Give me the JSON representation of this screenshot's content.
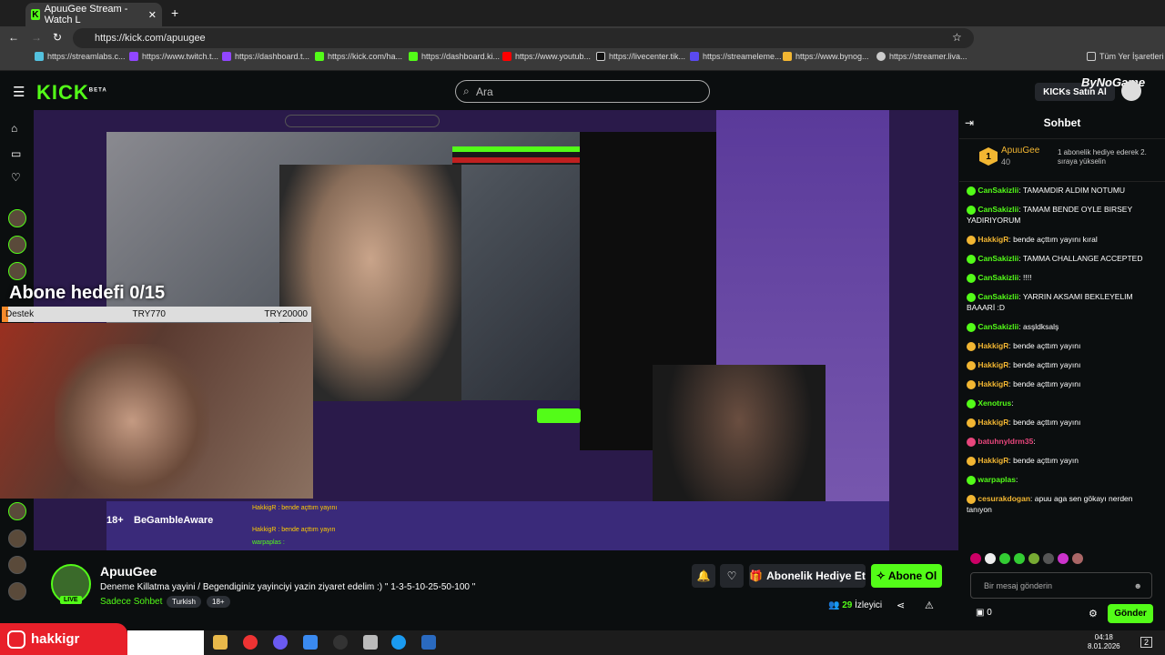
{
  "browser": {
    "tab_title": "ApuuGee Stream - Watch L",
    "url": "https://kick.com/apuugee",
    "bookmarks": [
      "https://streamlabs.c...",
      "https://www.twitch.t...",
      "https://dashboard.t...",
      "https://kick.com/ha...",
      "https://dashboard.ki...",
      "https://www.youtub...",
      "https://livecenter.tik...",
      "https://streameleme...",
      "https://www.bynog...",
      "https://streamer.liva..."
    ],
    "all_bookmarks": "Tüm Yer İşaretleri"
  },
  "header": {
    "logo": "KICK",
    "logo_sup": "BETA",
    "search_placeholder": "Ara",
    "kicks_button": "KICKs Satın Al",
    "overlay_logo": "ByNoGame"
  },
  "video": {
    "goal_title": "Abone hedefi 0/15",
    "goal_left": "Destek",
    "goal_mid": "TRY770",
    "goal_right": "TRY20000",
    "goal_progress": 0.0,
    "begamble": "BeGambleAware",
    "age": "18+",
    "overlay_lines": [
      "HakkigR : bende açttım yayını",
      "HakkigR : bende açttım yayın",
      "warpaplas :"
    ]
  },
  "stream": {
    "name": "ApuuGee",
    "title": "Deneme Killatma yayini / Begendiginiz yayinciyi yazin ziyaret edelim :) \" 1-3-5-10-25-50-100 \"",
    "category": "Sadece Sohbet",
    "tags": [
      "Turkish",
      "18+"
    ],
    "live": "LIVE",
    "viewers": "29",
    "viewers_label": "İzleyici",
    "gift_label": "Abonelik Hediye Et",
    "sub_label": "Abone Ol"
  },
  "chat": {
    "title": "Sohbet",
    "pinned": {
      "rank": "1",
      "name": "ApuuGee",
      "count": "40",
      "text": "1 abonelik hediye ederek 2. sıraya yükselin"
    },
    "messages": [
      {
        "user": "CanSakizlii",
        "color": "#53fc18",
        "text": "TAMAMDIR ALDIM NOTUMU"
      },
      {
        "user": "CanSakizlii",
        "color": "#53fc18",
        "text": "TAMAM BENDE OYLE BIRSEY YADIRIYORUM"
      },
      {
        "user": "HakkigR",
        "color": "#f2b632",
        "text": "bende açttım yayını kıral"
      },
      {
        "user": "CanSakizlii",
        "color": "#53fc18",
        "text": "TAMMA CHALLANGE ACCEPTED"
      },
      {
        "user": "CanSakizlii",
        "color": "#53fc18",
        "text": "!!!!"
      },
      {
        "user": "CanSakizlii",
        "color": "#53fc18",
        "text": "YARRIN AKSAMI BEKLEYELIM BAAARİ :D"
      },
      {
        "user": "CanSakizlii",
        "color": "#53fc18",
        "text": "asşldksalş"
      },
      {
        "user": "HakkigR",
        "color": "#f2b632",
        "text": "bende açttım yayını"
      },
      {
        "user": "HakkigR",
        "color": "#f2b632",
        "text": "bende açttım yayını"
      },
      {
        "user": "HakkigR",
        "color": "#f2b632",
        "text": "bende açttım yayını"
      },
      {
        "user": "Xenotrus",
        "color": "#53fc18",
        "text": ""
      },
      {
        "user": "HakkigR",
        "color": "#f2b632",
        "text": "bende açttım yayını"
      },
      {
        "user": "batuhnyldrm35",
        "color": "#e8467c",
        "text": ""
      },
      {
        "user": "HakkigR",
        "color": "#f2b632",
        "text": "bende açttım yayın"
      },
      {
        "user": "warpaplas",
        "color": "#53fc18",
        "text": ""
      },
      {
        "user": "cesurakdogan",
        "color": "#f2b632",
        "text": "apuu aga sen gökayı nerden tanıyon"
      }
    ],
    "input_placeholder": "Bir mesaj gönderin",
    "points": "0",
    "send_label": "Gönder"
  },
  "taskbar": {
    "instagram": "hakkigr",
    "time": "04:18",
    "date": "8.01.2026",
    "notif": "2"
  }
}
